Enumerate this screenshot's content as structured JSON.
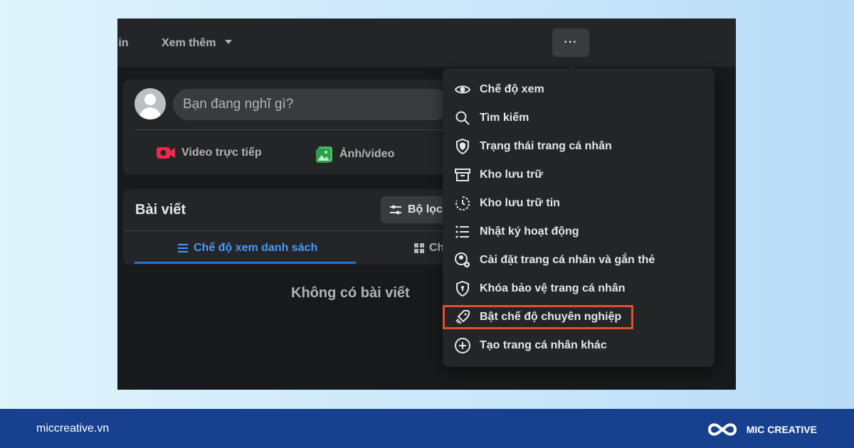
{
  "top_nav": {
    "partial_label": "k in",
    "see_more_label": "Xem thêm",
    "more_button_label": "···"
  },
  "composer": {
    "placeholder": "Bạn đang nghĩ gì?",
    "live_video_label": "Video trực tiếp",
    "photo_video_label": "Ảnh/video"
  },
  "posts": {
    "title": "Bài viết",
    "filter_label": "Bộ lọc",
    "list_view_label": "Chế độ xem danh sách",
    "grid_view_partial_label": "Ch",
    "empty_text": "Không có bài viết"
  },
  "menu": {
    "items": [
      {
        "label": "Chế độ xem",
        "icon": "eye-icon"
      },
      {
        "label": "Tìm kiếm",
        "icon": "search-icon"
      },
      {
        "label": "Trạng thái trang cá nhân",
        "icon": "shield-icon"
      },
      {
        "label": "Kho lưu trữ",
        "icon": "archive-icon"
      },
      {
        "label": "Kho lưu trữ tin",
        "icon": "story-archive-icon"
      },
      {
        "label": "Nhật ký hoạt động",
        "icon": "list-icon"
      },
      {
        "label": "Cài đặt trang cá nhân và gắn thẻ",
        "icon": "profile-settings-icon"
      },
      {
        "label": "Khóa bảo vệ trang cá nhân",
        "icon": "lock-shield-icon"
      },
      {
        "label": "Bật chế độ chuyên nghiệp",
        "icon": "professional-mode-icon",
        "highlighted": true
      },
      {
        "label": "Tạo trang cá nhân khác",
        "icon": "plus-circle-icon"
      }
    ]
  },
  "footer": {
    "website": "miccreative.vn",
    "brand": "MIC CREATIVE"
  },
  "colors": {
    "facebook_dark": "#18191a",
    "surface": "#242526",
    "accent_blue": "#2374e1",
    "highlight_orange": "#e0502d",
    "footer_blue": "#17418f"
  }
}
